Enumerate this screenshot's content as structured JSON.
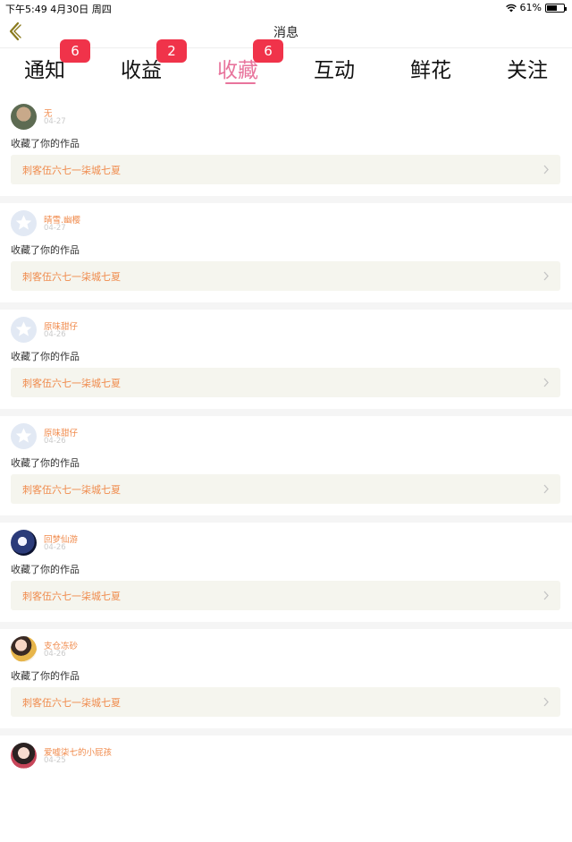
{
  "status_bar": {
    "time": "下午5:49   4月30日 周四",
    "battery_percent": "61%",
    "battery_level": 0.61
  },
  "nav": {
    "title": "消息",
    "back_icon": "chevron-left-icon"
  },
  "tabs": [
    {
      "label": "通知",
      "badge": "6",
      "active": false
    },
    {
      "label": "收益",
      "badge": "2",
      "active": false
    },
    {
      "label": "收藏",
      "badge": "6",
      "active": true
    },
    {
      "label": "互动",
      "badge": null,
      "active": false
    },
    {
      "label": "鲜花",
      "badge": null,
      "active": false
    },
    {
      "label": "关注",
      "badge": null,
      "active": false
    }
  ],
  "accent_color": "#e8749c",
  "badge_color": "#f0334a",
  "name_color": "#f08a4b",
  "messages": [
    {
      "user": "无",
      "date": "04-27",
      "action": "收藏了你的作品",
      "work": "刺客伍六七一柒城七夏",
      "avatar": "photo"
    },
    {
      "user": "晴雪.幽樱",
      "date": "04-27",
      "action": "收藏了你的作品",
      "work": "刺客伍六七一柒城七夏",
      "avatar": "default-star"
    },
    {
      "user": "原味甜仔",
      "date": "04-26",
      "action": "收藏了你的作品",
      "work": "刺客伍六七一柒城七夏",
      "avatar": "default-star"
    },
    {
      "user": "原味甜仔",
      "date": "04-26",
      "action": "收藏了你的作品",
      "work": "刺客伍六七一柒城七夏",
      "avatar": "default-star"
    },
    {
      "user": "回梦仙游",
      "date": "04-26",
      "action": "收藏了你的作品",
      "work": "刺客伍六七一柒城七夏",
      "avatar": "photo"
    },
    {
      "user": "支仓冻砂",
      "date": "04-26",
      "action": "收藏了你的作品",
      "work": "刺客伍六七一柒城七夏",
      "avatar": "photo"
    },
    {
      "user": "爱嘘柒七的小屁孩",
      "date": "04-25",
      "action": "",
      "work": "",
      "avatar": "photo"
    }
  ]
}
